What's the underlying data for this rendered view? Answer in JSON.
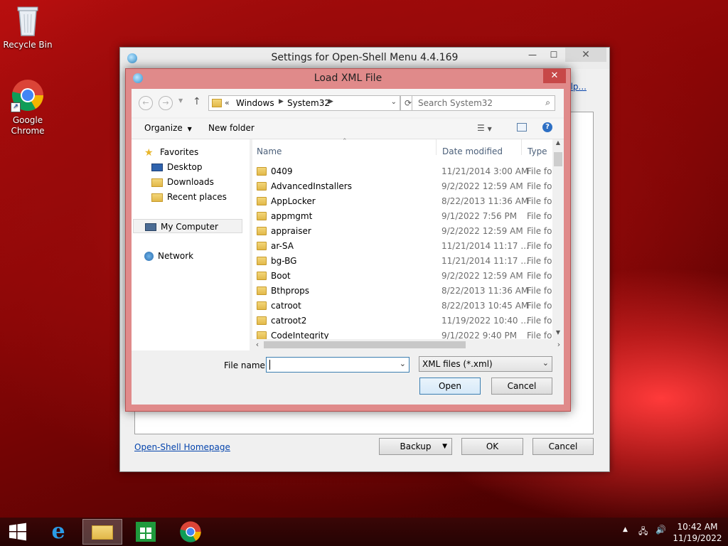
{
  "desktop": {
    "icons": [
      {
        "label": "Recycle Bin",
        "icon": "recycle-bin-icon"
      },
      {
        "label": "Google\nChrome",
        "icon": "chrome-icon"
      }
    ]
  },
  "settings_window": {
    "title": "Settings for Open-Shell Menu 4.4.169",
    "help_link": "elp...",
    "homepage_link": "Open-Shell Homepage",
    "backup_label": "Backup",
    "ok_label": "OK",
    "cancel_label": "Cancel"
  },
  "dialog": {
    "title": "Load XML File",
    "close_label": "✕",
    "breadcrumb": {
      "root": "«",
      "items": [
        "Windows",
        "System32"
      ]
    },
    "search_placeholder": "Search System32",
    "toolbar": {
      "organize": "Organize",
      "new_folder": "New folder"
    },
    "nav": {
      "favorites": "Favorites",
      "desktop": "Desktop",
      "downloads": "Downloads",
      "recent": "Recent places",
      "my_computer": "My Computer",
      "network": "Network"
    },
    "columns": {
      "name": "Name",
      "date": "Date modified",
      "type": "Type"
    },
    "rows": [
      {
        "name": "0409",
        "date": "11/21/2014 3:00 AM",
        "type": "File fol"
      },
      {
        "name": "AdvancedInstallers",
        "date": "9/2/2022 12:59 AM",
        "type": "File fol"
      },
      {
        "name": "AppLocker",
        "date": "8/22/2013 11:36 AM",
        "type": "File fol"
      },
      {
        "name": "appmgmt",
        "date": "9/1/2022 7:56 PM",
        "type": "File fol"
      },
      {
        "name": "appraiser",
        "date": "9/2/2022 12:59 AM",
        "type": "File fol"
      },
      {
        "name": "ar-SA",
        "date": "11/21/2014 11:17 ...",
        "type": "File fol"
      },
      {
        "name": "bg-BG",
        "date": "11/21/2014 11:17 ...",
        "type": "File fol"
      },
      {
        "name": "Boot",
        "date": "9/2/2022 12:59 AM",
        "type": "File fol"
      },
      {
        "name": "Bthprops",
        "date": "8/22/2013 11:36 AM",
        "type": "File fol"
      },
      {
        "name": "catroot",
        "date": "8/22/2013 10:45 AM",
        "type": "File fol"
      },
      {
        "name": "catroot2",
        "date": "11/19/2022 10:40 ...",
        "type": "File fol"
      },
      {
        "name": "CodeIntegrity",
        "date": "9/1/2022 9:40 PM",
        "type": "File fol"
      }
    ],
    "filename_label": "File name:",
    "filename_value": "",
    "filetype_value": "XML files (*.xml)",
    "open_label": "Open",
    "cancel_label": "Cancel"
  },
  "taskbar": {
    "time": "10:42 AM",
    "date": "11/19/2022"
  }
}
